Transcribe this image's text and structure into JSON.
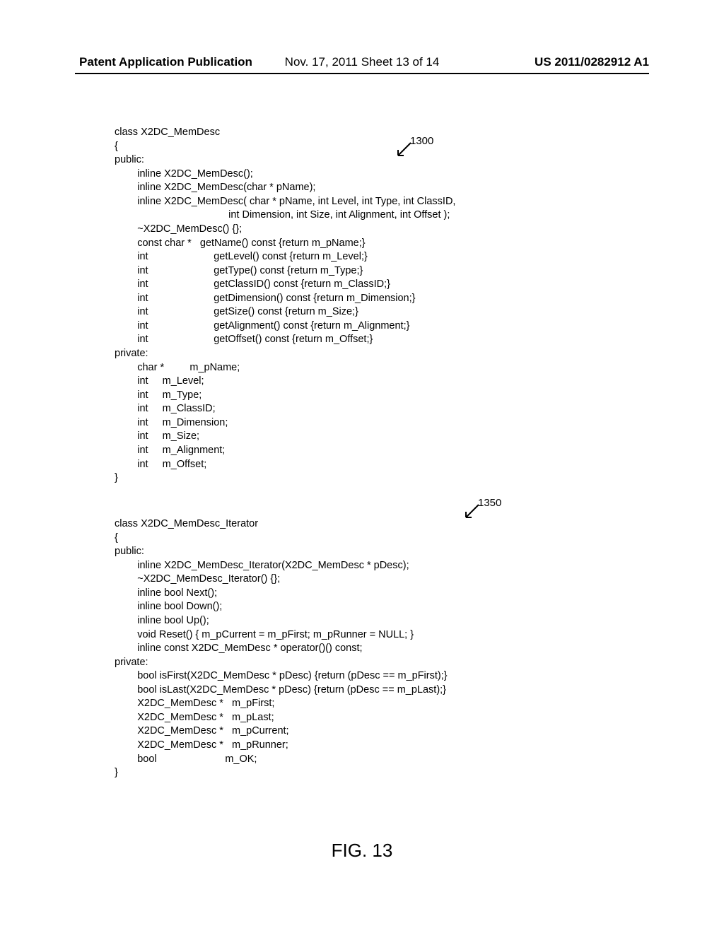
{
  "header": {
    "left": "Patent Application Publication",
    "center": "Nov. 17, 2011  Sheet 13 of 14",
    "right": "US 2011/0282912 A1"
  },
  "figure_labels": {
    "ref_1300": "1300",
    "ref_1350": "1350"
  },
  "code1": "class X2DC_MemDesc\n{\npublic:\n        inline X2DC_MemDesc();\n        inline X2DC_MemDesc(char * pName);\n        inline X2DC_MemDesc( char * pName, int Level, int Type, int ClassID,\n                                        int Dimension, int Size, int Alignment, int Offset );\n        ~X2DC_MemDesc() {};\n        const char *   getName() const {return m_pName;}\n        int                       getLevel() const {return m_Level;}\n        int                       getType() const {return m_Type;}\n        int                       getClassID() const {return m_ClassID;}\n        int                       getDimension() const {return m_Dimension;}\n        int                       getSize() const {return m_Size;}\n        int                       getAlignment() const {return m_Alignment;}\n        int                       getOffset() const {return m_Offset;}\nprivate:\n        char *         m_pName;\n        int     m_Level;\n        int     m_Type;\n        int     m_ClassID;\n        int     m_Dimension;\n        int     m_Size;\n        int     m_Alignment;\n        int     m_Offset;\n}",
  "code2": "class X2DC_MemDesc_Iterator\n{\npublic:\n        inline X2DC_MemDesc_Iterator(X2DC_MemDesc * pDesc);\n        ~X2DC_MemDesc_Iterator() {};\n        inline bool Next();\n        inline bool Down();\n        inline bool Up();\n        void Reset() { m_pCurrent = m_pFirst; m_pRunner = NULL; }\n        inline const X2DC_MemDesc * operator()() const;\nprivate:\n        bool isFirst(X2DC_MemDesc * pDesc) {return (pDesc == m_pFirst);}\n        bool isLast(X2DC_MemDesc * pDesc) {return (pDesc == m_pLast);}\n        X2DC_MemDesc *   m_pFirst;\n        X2DC_MemDesc *   m_pLast;\n        X2DC_MemDesc *   m_pCurrent;\n        X2DC_MemDesc *   m_pRunner;\n        bool                        m_OK;\n}",
  "figure_caption": "FIG. 13"
}
